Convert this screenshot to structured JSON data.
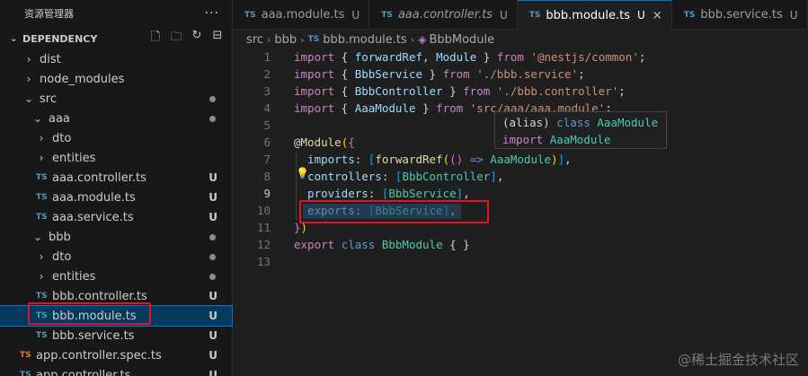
{
  "explorer": {
    "title": "资源管理器",
    "more": "···",
    "section_label": "DEPENDENCY",
    "action_icons": [
      "new-file-icon",
      "new-folder-icon",
      "refresh-icon",
      "collapse-all-icon"
    ]
  },
  "tree": [
    {
      "label": "dist",
      "kind": "folder",
      "expanded": false,
      "depth": 1,
      "status": ""
    },
    {
      "label": "node_modules",
      "kind": "folder",
      "expanded": false,
      "depth": 1,
      "status": ""
    },
    {
      "label": "src",
      "kind": "folder",
      "expanded": true,
      "depth": 1,
      "status": "dot"
    },
    {
      "label": "aaa",
      "kind": "folder",
      "expanded": true,
      "depth": 2,
      "status": "dot"
    },
    {
      "label": "dto",
      "kind": "folder",
      "expanded": false,
      "depth": 3,
      "status": ""
    },
    {
      "label": "entities",
      "kind": "folder",
      "expanded": false,
      "depth": 3,
      "status": ""
    },
    {
      "label": "aaa.controller.ts",
      "kind": "ts",
      "depth": 3,
      "status": "U"
    },
    {
      "label": "aaa.module.ts",
      "kind": "ts",
      "depth": 3,
      "status": "U"
    },
    {
      "label": "aaa.service.ts",
      "kind": "ts",
      "depth": 3,
      "status": "U"
    },
    {
      "label": "bbb",
      "kind": "folder",
      "expanded": true,
      "depth": 2,
      "status": "dot"
    },
    {
      "label": "dto",
      "kind": "folder",
      "expanded": false,
      "depth": 3,
      "status": "dot"
    },
    {
      "label": "entities",
      "kind": "folder",
      "expanded": false,
      "depth": 3,
      "status": "dot"
    },
    {
      "label": "bbb.controller.ts",
      "kind": "ts",
      "depth": 3,
      "status": "U"
    },
    {
      "label": "bbb.module.ts",
      "kind": "ts",
      "depth": 3,
      "status": "U",
      "selected": true
    },
    {
      "label": "bbb.service.ts",
      "kind": "ts",
      "depth": 3,
      "status": "U"
    },
    {
      "label": "app.controller.spec.ts",
      "kind": "spec",
      "depth": 2,
      "status": "U"
    },
    {
      "label": "app.controller.ts",
      "kind": "ts",
      "depth": 2,
      "status": "U"
    }
  ],
  "tabs": [
    {
      "name": "aaa.module.ts",
      "status": "U",
      "italic": false,
      "active": false
    },
    {
      "name": "aaa.controller.ts",
      "status": "U",
      "italic": true,
      "active": false
    },
    {
      "name": "bbb.module.ts",
      "status": "U",
      "italic": false,
      "active": true
    },
    {
      "name": "bbb.service.ts",
      "status": "U",
      "italic": false,
      "active": false
    }
  ],
  "breadcrumb": [
    "src",
    "bbb",
    "bbb.module.ts",
    "BbbModule"
  ],
  "current_line": 9,
  "code_lines": [
    [
      [
        "import",
        "kc"
      ],
      [
        " { ",
        "p"
      ],
      [
        "forwardRef",
        "v"
      ],
      [
        ", ",
        "p"
      ],
      [
        "Module",
        "v"
      ],
      [
        " } ",
        "p"
      ],
      [
        "from",
        "kc"
      ],
      [
        " ",
        "p"
      ],
      [
        "'@nestjs/common'",
        "s"
      ],
      [
        ";",
        "p"
      ]
    ],
    [
      [
        "import",
        "kc"
      ],
      [
        " { ",
        "p"
      ],
      [
        "BbbService",
        "v"
      ],
      [
        " } ",
        "p"
      ],
      [
        "from",
        "kc"
      ],
      [
        " ",
        "p"
      ],
      [
        "'./bbb.service'",
        "s"
      ],
      [
        ";",
        "p"
      ]
    ],
    [
      [
        "import",
        "kc"
      ],
      [
        " { ",
        "p"
      ],
      [
        "BbbController",
        "v"
      ],
      [
        " } ",
        "p"
      ],
      [
        "from",
        "kc"
      ],
      [
        " ",
        "p"
      ],
      [
        "'./bbb.controller'",
        "s"
      ],
      [
        ";",
        "p"
      ]
    ],
    [
      [
        "import",
        "kc"
      ],
      [
        " { ",
        "p"
      ],
      [
        "AaaModule",
        "v"
      ],
      [
        " } ",
        "p"
      ],
      [
        "from",
        "kc"
      ],
      [
        " ",
        "p"
      ],
      [
        "'src/aaa/aaa.module'",
        "s"
      ],
      [
        ";",
        "p"
      ]
    ],
    [],
    [
      [
        "@",
        "p"
      ],
      [
        "Module",
        "f"
      ],
      [
        "(",
        "b1"
      ],
      [
        "{",
        "b2"
      ]
    ],
    [
      [
        "  imports",
        "v"
      ],
      [
        ": ",
        "p"
      ],
      [
        "[",
        "b3"
      ],
      [
        "forwardRef",
        "f"
      ],
      [
        "(",
        "b1"
      ],
      [
        "()",
        "b2"
      ],
      [
        " => ",
        "k"
      ],
      [
        "AaaModule",
        "t"
      ],
      [
        ")",
        "b1"
      ],
      [
        "]",
        "b3"
      ],
      [
        ",",
        "p"
      ]
    ],
    [
      [
        "  controllers",
        "v"
      ],
      [
        ": ",
        "p"
      ],
      [
        "[",
        "b3"
      ],
      [
        "BbbController",
        "t"
      ],
      [
        "]",
        "b3"
      ],
      [
        ",",
        "p"
      ]
    ],
    [
      [
        "  providers",
        "v"
      ],
      [
        ": ",
        "p"
      ],
      [
        "[",
        "b3"
      ],
      [
        "BbbService",
        "t"
      ],
      [
        "]",
        "b3"
      ],
      [
        ",",
        "p"
      ]
    ],
    [
      [
        "  exports",
        "v"
      ],
      [
        ": ",
        "p"
      ],
      [
        "[",
        "b3"
      ],
      [
        "BbbService",
        "t"
      ],
      [
        "]",
        "b3"
      ],
      [
        ",",
        "p"
      ]
    ],
    [
      [
        "}",
        "b2"
      ],
      [
        ")",
        "b1"
      ]
    ],
    [
      [
        "export",
        "kc"
      ],
      [
        " ",
        "p"
      ],
      [
        "class",
        "k"
      ],
      [
        " ",
        "p"
      ],
      [
        "BbbModule",
        "t"
      ],
      [
        " { }",
        "p"
      ]
    ],
    []
  ],
  "hover": {
    "line1": [
      "(alias)",
      "class",
      "AaaModule"
    ],
    "line2": [
      "import",
      "AaaModule"
    ]
  },
  "watermark": "@稀土掘金技术社区",
  "colors": {
    "accent": "#0078d4",
    "highlight_box": "#e81123",
    "ts_icon": "#519aba"
  }
}
